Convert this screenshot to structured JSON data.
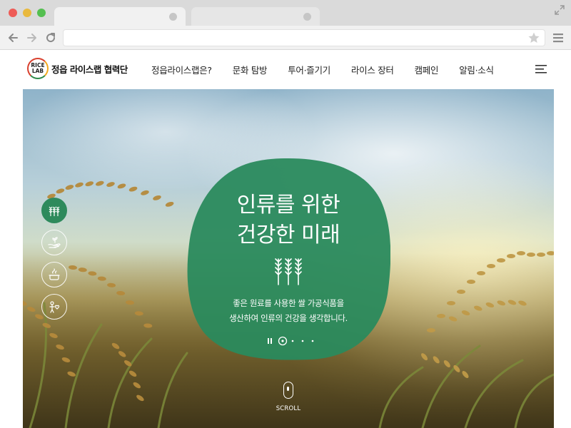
{
  "browser": {
    "address_value": "",
    "colors": {
      "close": "#ee5b56",
      "minimize": "#e9b93e",
      "maximize": "#54bf50"
    },
    "icons": [
      "back-arrow-icon",
      "forward-arrow-icon",
      "reload-icon",
      "bookmark-star-icon",
      "browser-menu-icon",
      "fullscreen-icon"
    ]
  },
  "site": {
    "logo": {
      "mark_line1": "RICE",
      "mark_line2": "LAB",
      "text": "정읍 라이스랩 협력단"
    },
    "nav": [
      "정읍라이스랩은?",
      "문화 탐방",
      "투어·즐기기",
      "라이스 장터",
      "캠페인",
      "알림·소식"
    ],
    "menu_icon": "hamburger-icon"
  },
  "hero": {
    "title_line1": "인류를 위한",
    "title_line2": "건강한 미래",
    "desc_line1": "좋은 원료를 사용한 쌀 가공식품을",
    "desc_line2": "생산하여 인류의 건강을 생각합니다.",
    "scroll_label": "SCROLL",
    "side_icons": [
      "wheat-icon",
      "hand-seedling-icon",
      "cooking-pot-icon",
      "person-heart-icon"
    ],
    "active_slide": 1,
    "slide_count": 4,
    "accent_color": "#2a8a5d"
  }
}
